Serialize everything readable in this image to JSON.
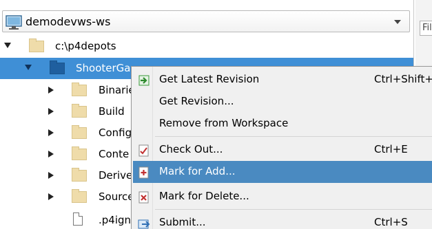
{
  "workspace": {
    "name": "demodevws-ws",
    "icon": "computer-monitor-icon"
  },
  "right_pane": {
    "filter_label": "Fil"
  },
  "tree": {
    "root": {
      "label": "c:\\p4depots",
      "icon": "folder-icon"
    },
    "selected": {
      "label": "ShooterGa",
      "icon": "folder-icon"
    },
    "children": [
      {
        "label": "Binarie",
        "icon": "folder-icon"
      },
      {
        "label": "Build",
        "icon": "folder-icon"
      },
      {
        "label": "Config",
        "icon": "folder-icon"
      },
      {
        "label": "Conte",
        "icon": "folder-icon"
      },
      {
        "label": "Derive",
        "icon": "folder-icon"
      },
      {
        "label": "Source",
        "icon": "folder-icon"
      }
    ],
    "file": {
      "label": ".p4ign",
      "icon": "file-icon"
    }
  },
  "context_menu": {
    "items": [
      {
        "label": "Get Latest Revision",
        "shortcut": "Ctrl+Shift+",
        "icon": "get-latest-icon",
        "accent": "#3a9a3a"
      },
      {
        "label": "Get Revision...",
        "shortcut": "",
        "icon": ""
      },
      {
        "label": "Remove from Workspace",
        "shortcut": "",
        "icon": ""
      },
      {
        "label": "Check Out...",
        "shortcut": "Ctrl+E",
        "icon": "check-out-icon",
        "accent": "#c23030"
      },
      {
        "label": "Mark for Add...",
        "shortcut": "",
        "icon": "mark-for-add-icon",
        "accent": "#c23030",
        "highlighted": true
      },
      {
        "label": "Mark for Delete...",
        "shortcut": "",
        "icon": "mark-for-delete-icon",
        "accent": "#c23030"
      },
      {
        "label": "Submit...",
        "shortcut": "Ctrl+S",
        "icon": "submit-icon",
        "accent": "#2f6fb5"
      }
    ]
  },
  "colors": {
    "selection": "#3f8fd6",
    "menu_highlight": "#4a8ac1",
    "folder": "#efdcaa"
  }
}
